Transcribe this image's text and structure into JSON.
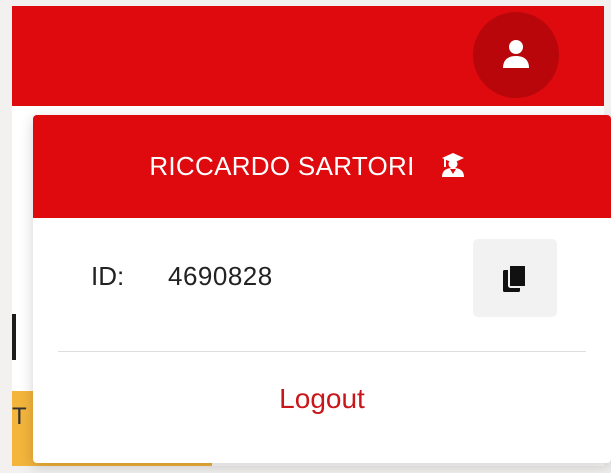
{
  "user_menu": {
    "user_name": "RICCARDO SARTORI",
    "id_label": "ID:",
    "id_value": "4690828",
    "logout_label": "Logout",
    "header_icon": "graduate-icon",
    "copy_icon": "copy-icon",
    "avatar_icon": "user-icon"
  },
  "partial_background": {
    "left_strip_text": "T"
  },
  "colors": {
    "brand_red": "#de0a0e",
    "avatar_bg": "#b8060b",
    "logout_red": "#c8161b",
    "strip_orange": "#f3b53c"
  }
}
